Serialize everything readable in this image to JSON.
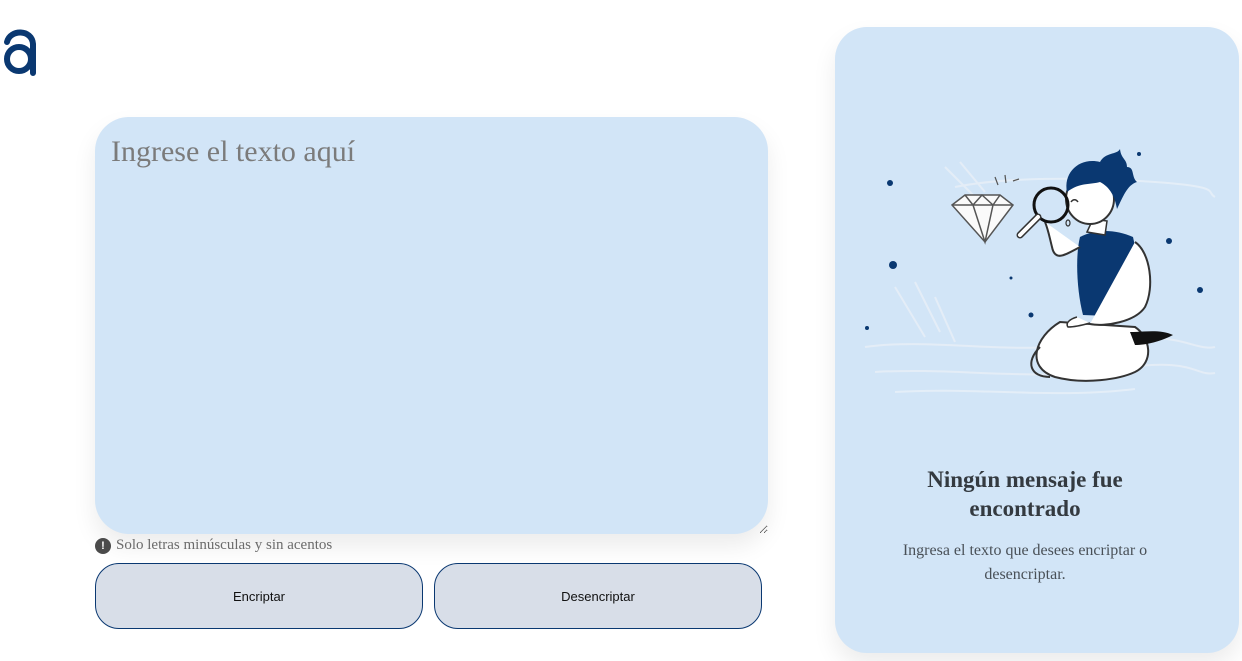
{
  "logo": {
    "icon": "alura-a-logo"
  },
  "editor": {
    "placeholder": "Ingrese el texto aquí",
    "value": ""
  },
  "hint": {
    "icon": "exclamation-circle-icon",
    "text": "Solo letras minúsculas y sin acentos"
  },
  "buttons": {
    "encrypt_label": "Encriptar",
    "decrypt_label": "Desencriptar"
  },
  "output": {
    "illustration": "person-with-magnifying-glass-examining-diamond",
    "title": "Ningún mensaje fue encontrado",
    "text": "Ingresa el texto que desees encriptar o desencriptar."
  },
  "colors": {
    "accent": "#0a3871",
    "panel_bg": "#d2e5f7",
    "button_bg": "#d8dee8"
  }
}
